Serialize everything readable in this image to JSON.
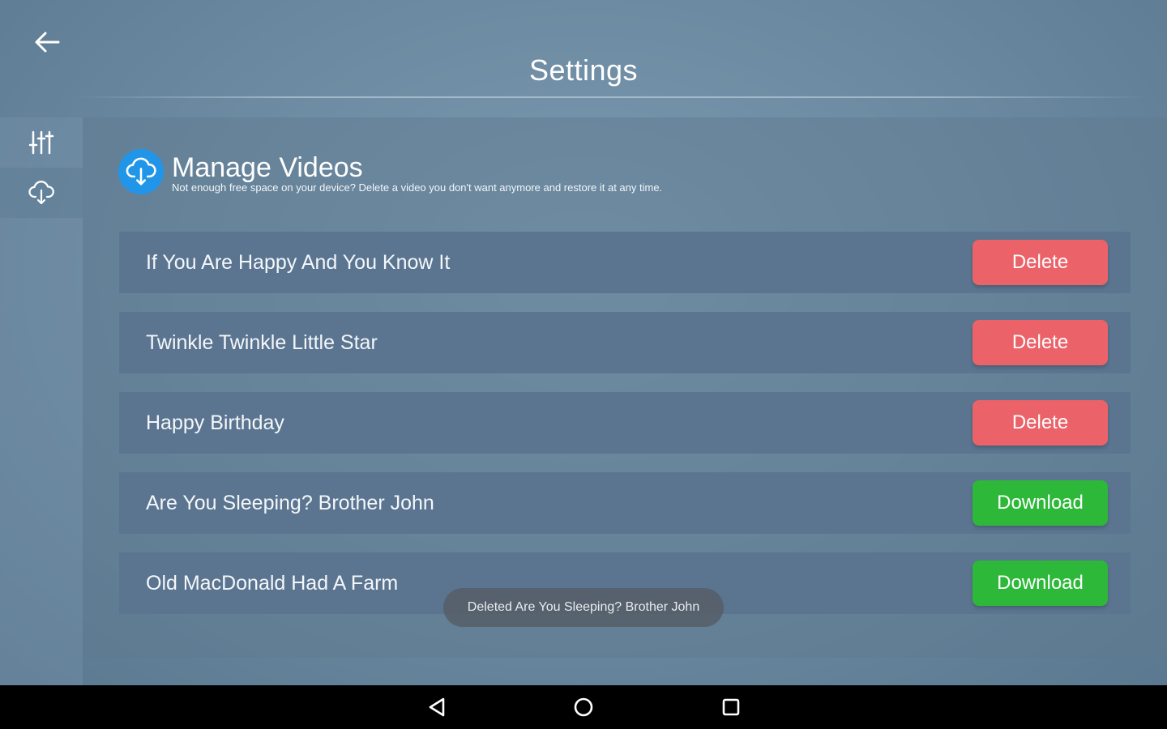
{
  "header": {
    "title": "Settings",
    "back_icon": "arrow-left-icon"
  },
  "sidebar": {
    "items": [
      {
        "icon": "sliders-icon",
        "active": false
      },
      {
        "icon": "cloud-download-icon",
        "active": true
      }
    ]
  },
  "section": {
    "icon": "cloud-download-icon",
    "icon_color": "#2196e8",
    "title": "Manage Videos",
    "subtitle": "Not enough free space on your device? Delete a video you don't want anymore and restore it at any time."
  },
  "videos": [
    {
      "title": "If You Are Happy And You Know It",
      "action": "Delete"
    },
    {
      "title": "Twinkle Twinkle Little Star",
      "action": "Delete"
    },
    {
      "title": "Happy Birthday",
      "action": "Delete"
    },
    {
      "title": "Are You Sleeping? Brother John",
      "action": "Download"
    },
    {
      "title": "Old MacDonald Had A Farm",
      "action": "Download"
    }
  ],
  "colors": {
    "delete": "#ec6269",
    "download": "#2db83a"
  },
  "toast": {
    "text": "Deleted Are You Sleeping? Brother John"
  },
  "navbar": {
    "items": [
      "back-triangle-icon",
      "home-circle-icon",
      "recents-square-icon"
    ]
  }
}
